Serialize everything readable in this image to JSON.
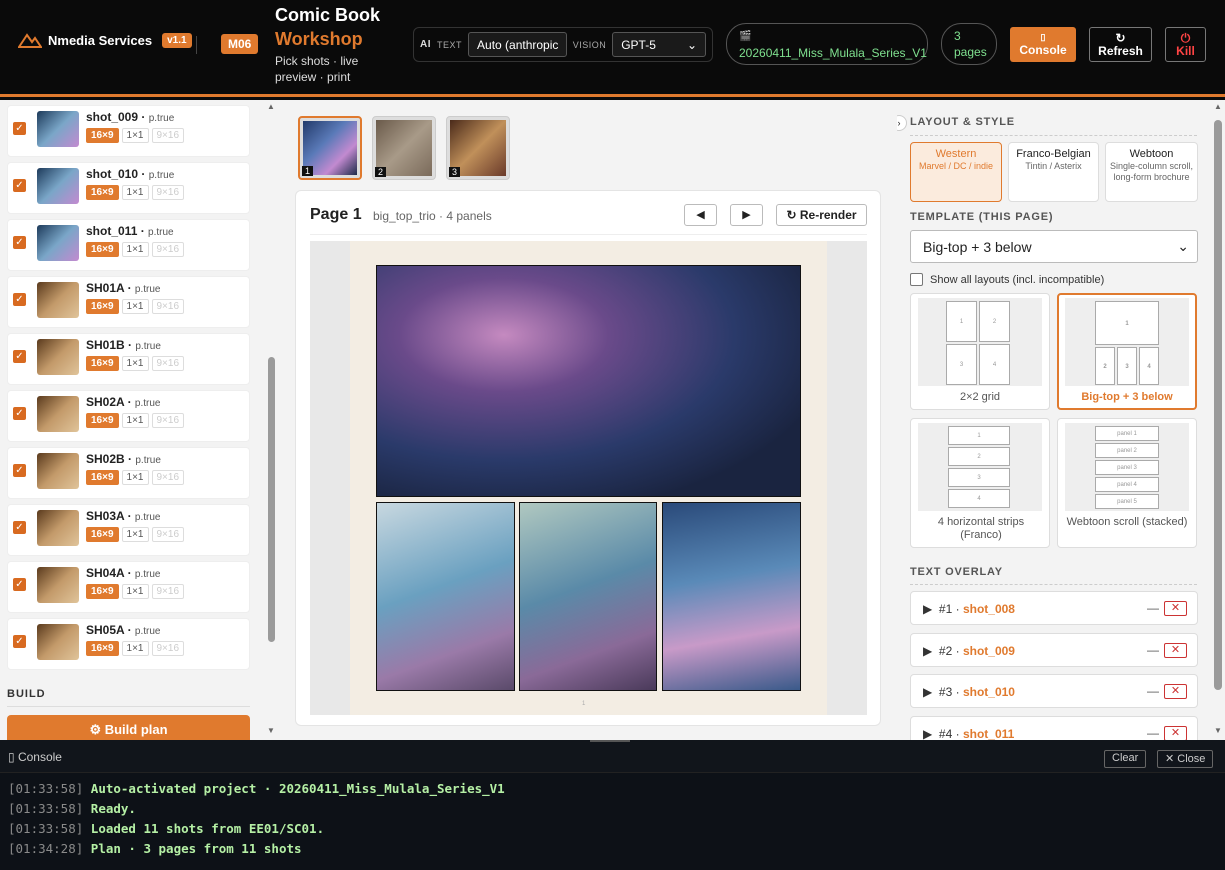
{
  "header": {
    "brand": "Nmedia Services",
    "version": "v1.1",
    "module": "M06",
    "title_line1": "Comic Book",
    "title_line2": "Workshop",
    "subtitle": "Pick shots · live preview · print",
    "ai_label": "AI",
    "text_label": "TEXT",
    "text_model": "Auto (anthropic",
    "vision_label": "VISION",
    "vision_model": "GPT-5",
    "project_name": "20260411_Miss_Mulala_Series_V1",
    "pages_count": "3",
    "pages_label": "pages",
    "console_label": "Console",
    "refresh_label": "Refresh",
    "kill_label": "Kill"
  },
  "shots": [
    {
      "name": "shot_009",
      "flag": "p.true",
      "chips": [
        "16×9",
        "1×1",
        "9×16"
      ]
    },
    {
      "name": "shot_010",
      "flag": "p.true",
      "chips": [
        "16×9",
        "1×1",
        "9×16"
      ]
    },
    {
      "name": "shot_011",
      "flag": "p.true",
      "chips": [
        "16×9",
        "1×1",
        "9×16"
      ]
    },
    {
      "name": "SH01A",
      "flag": "p.true",
      "chips": [
        "16×9",
        "1×1",
        "9×16"
      ]
    },
    {
      "name": "SH01B",
      "flag": "p.true",
      "chips": [
        "16×9",
        "1×1",
        "9×16"
      ]
    },
    {
      "name": "SH02A",
      "flag": "p.true",
      "chips": [
        "16×9",
        "1×1",
        "9×16"
      ]
    },
    {
      "name": "SH02B",
      "flag": "p.true",
      "chips": [
        "16×9",
        "1×1",
        "9×16"
      ]
    },
    {
      "name": "SH03A",
      "flag": "p.true",
      "chips": [
        "16×9",
        "1×1",
        "9×16"
      ]
    },
    {
      "name": "SH04A",
      "flag": "p.true",
      "chips": [
        "16×9",
        "1×1",
        "9×16"
      ]
    },
    {
      "name": "SH05A",
      "flag": "p.true",
      "chips": [
        "16×9",
        "1×1",
        "9×16"
      ]
    }
  ],
  "build": {
    "label": "BUILD",
    "button": "Build plan"
  },
  "preview": {
    "page_thumbs": [
      "1",
      "2",
      "3"
    ],
    "page_title": "Page 1",
    "page_meta": "big_top_trio · 4 panels",
    "prev": "◀",
    "next": "▶",
    "rerender": "Re-render",
    "page_footer": "1"
  },
  "right": {
    "layout_section": "LAYOUT & STYLE",
    "layouts": [
      {
        "name": "Western",
        "desc": "Marvel / DC / indie"
      },
      {
        "name": "Franco-Belgian",
        "desc": "Tintin / Asterix"
      },
      {
        "name": "Webtoon",
        "desc": "Single-column scroll, long-form brochure"
      }
    ],
    "template_section": "TEMPLATE (THIS PAGE)",
    "template_value": "Big-top + 3 below",
    "show_all": "Show all layouts (incl. incompatible)",
    "templates": [
      {
        "name": "2×2 grid"
      },
      {
        "name": "Big-top + 3 below"
      },
      {
        "name": "4 horizontal strips (Franco)"
      },
      {
        "name": "Webtoon scroll (stacked)"
      }
    ],
    "overlay_section": "TEXT OVERLAY",
    "overlays": [
      {
        "idx": "#1 ·",
        "shot": "shot_008"
      },
      {
        "idx": "#2 ·",
        "shot": "shot_009"
      },
      {
        "idx": "#3 ·",
        "shot": "shot_010"
      },
      {
        "idx": "#4 ·",
        "shot": "shot_011"
      }
    ]
  },
  "console": {
    "title": "Console",
    "clear": "Clear",
    "close": "Close",
    "logs": [
      {
        "time": "[01:33:58]",
        "msg": "Auto-activated project · 20260411_Miss_Mulala_Series_V1"
      },
      {
        "time": "[01:33:58]",
        "msg": "Ready."
      },
      {
        "time": "[01:33:58]",
        "msg": "Loaded 11 shots from EE01/SC01."
      },
      {
        "time": "[01:34:28]",
        "msg": "Plan · 3 pages from 11 shots"
      }
    ]
  }
}
